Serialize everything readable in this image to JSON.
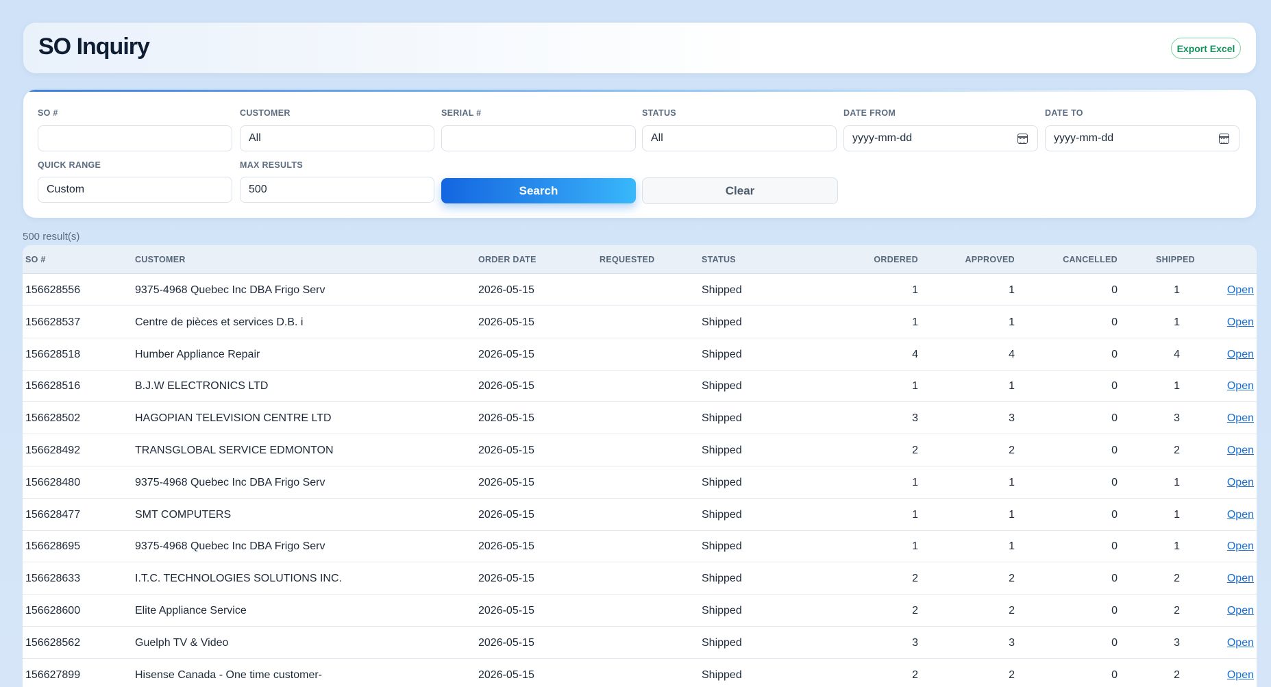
{
  "header": {
    "title": "SO Inquiry",
    "export_label": "Export Excel"
  },
  "filters": {
    "so_label": "SO #",
    "so_value": "",
    "customer_label": "CUSTOMER",
    "customer_value": "All",
    "serial_label": "SERIAL #",
    "serial_value": "",
    "status_label": "STATUS",
    "status_value": "All",
    "date_from_label": "DATE FROM",
    "date_from_value": "yyyy-mm-dd",
    "date_to_label": "DATE TO",
    "date_to_value": "yyyy-mm-dd",
    "quick_range_label": "QUICK RANGE",
    "quick_range_value": "Custom",
    "max_results_label": "MAX RESULTS",
    "max_results_value": "500",
    "search_label": "Search",
    "clear_label": "Clear"
  },
  "results": {
    "count_text": "500 result(s)"
  },
  "table": {
    "columns": {
      "so": "SO #",
      "customer": "CUSTOMER",
      "order_date": "ORDER DATE",
      "requested": "REQUESTED",
      "status": "STATUS",
      "ordered": "ORDERED",
      "approved": "APPROVED",
      "cancelled": "CANCELLED",
      "shipped": "SHIPPED"
    },
    "open_label": "Open",
    "rows": [
      {
        "so": "156628556",
        "customer": "9375-4968 Quebec Inc DBA Frigo Serv",
        "order_date": "2026-05-15",
        "requested": "",
        "status": "Shipped",
        "ordered": "1",
        "approved": "1",
        "cancelled": "0",
        "shipped": "1"
      },
      {
        "so": "156628537",
        "customer": "Centre de pièces et services D.B. i",
        "order_date": "2026-05-15",
        "requested": "",
        "status": "Shipped",
        "ordered": "1",
        "approved": "1",
        "cancelled": "0",
        "shipped": "1"
      },
      {
        "so": "156628518",
        "customer": "Humber Appliance Repair",
        "order_date": "2026-05-15",
        "requested": "",
        "status": "Shipped",
        "ordered": "4",
        "approved": "4",
        "cancelled": "0",
        "shipped": "4"
      },
      {
        "so": "156628516",
        "customer": "B.J.W ELECTRONICS LTD",
        "order_date": "2026-05-15",
        "requested": "",
        "status": "Shipped",
        "ordered": "1",
        "approved": "1",
        "cancelled": "0",
        "shipped": "1"
      },
      {
        "so": "156628502",
        "customer": "HAGOPIAN TELEVISION CENTRE LTD",
        "order_date": "2026-05-15",
        "requested": "",
        "status": "Shipped",
        "ordered": "3",
        "approved": "3",
        "cancelled": "0",
        "shipped": "3"
      },
      {
        "so": "156628492",
        "customer": "TRANSGLOBAL SERVICE EDMONTON",
        "order_date": "2026-05-15",
        "requested": "",
        "status": "Shipped",
        "ordered": "2",
        "approved": "2",
        "cancelled": "0",
        "shipped": "2"
      },
      {
        "so": "156628480",
        "customer": "9375-4968 Quebec Inc DBA Frigo Serv",
        "order_date": "2026-05-15",
        "requested": "",
        "status": "Shipped",
        "ordered": "1",
        "approved": "1",
        "cancelled": "0",
        "shipped": "1"
      },
      {
        "so": "156628477",
        "customer": "SMT COMPUTERS",
        "order_date": "2026-05-15",
        "requested": "",
        "status": "Shipped",
        "ordered": "1",
        "approved": "1",
        "cancelled": "0",
        "shipped": "1"
      },
      {
        "so": "156628695",
        "customer": "9375-4968 Quebec Inc DBA Frigo Serv",
        "order_date": "2026-05-15",
        "requested": "",
        "status": "Shipped",
        "ordered": "1",
        "approved": "1",
        "cancelled": "0",
        "shipped": "1"
      },
      {
        "so": "156628633",
        "customer": "I.T.C. TECHNOLOGIES SOLUTIONS INC.",
        "order_date": "2026-05-15",
        "requested": "",
        "status": "Shipped",
        "ordered": "2",
        "approved": "2",
        "cancelled": "0",
        "shipped": "2"
      },
      {
        "so": "156628600",
        "customer": "Elite Appliance Service",
        "order_date": "2026-05-15",
        "requested": "",
        "status": "Shipped",
        "ordered": "2",
        "approved": "2",
        "cancelled": "0",
        "shipped": "2"
      },
      {
        "so": "156628562",
        "customer": "Guelph TV & Video",
        "order_date": "2026-05-15",
        "requested": "",
        "status": "Shipped",
        "ordered": "3",
        "approved": "3",
        "cancelled": "0",
        "shipped": "3"
      },
      {
        "so": "156627899",
        "customer": "Hisense Canada - One time customer-",
        "order_date": "2026-05-15",
        "requested": "",
        "status": "Shipped",
        "ordered": "2",
        "approved": "2",
        "cancelled": "0",
        "shipped": "2"
      }
    ]
  }
}
